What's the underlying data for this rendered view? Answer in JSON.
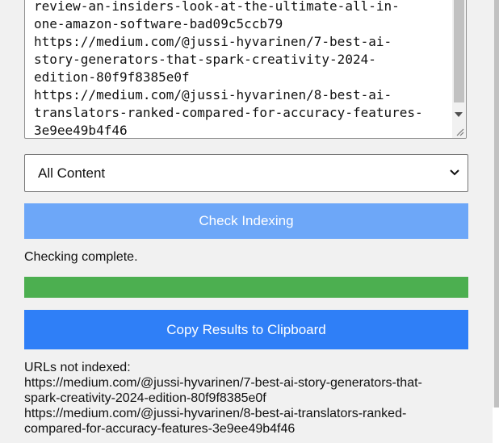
{
  "url_input": {
    "lines": [
      "review-an-insiders-look-at-the-ultimate-all-in-",
      "one-amazon-software-bad09c5ccb79",
      "https://medium.com/@jussi-hyvarinen/7-best-ai-",
      "story-generators-that-spark-creativity-2024-",
      "edition-80f9f8385e0f",
      "https://medium.com/@jussi-hyvarinen/8-best-ai-",
      "translators-ranked-compared-for-accuracy-features-",
      "3e9ee49b4f46"
    ]
  },
  "content_select": {
    "value": "All Content"
  },
  "buttons": {
    "check_label": "Check Indexing",
    "copy_label": "Copy Results to Clipboard"
  },
  "status": {
    "text": "Checking complete.",
    "progress_percent": 100,
    "progress_color": "#4caf50"
  },
  "results": {
    "heading": "URLs not indexed:",
    "lines": [
      "https://medium.com/@jussi-hyvarinen/7-best-ai-story-generators-that-",
      "spark-creativity-2024-edition-80f9f8385e0f",
      "https://medium.com/@jussi-hyvarinen/8-best-ai-translators-ranked-",
      "compared-for-accuracy-features-3e9ee49b4f46"
    ],
    "partial_text": "........"
  },
  "colors": {
    "check_button": "#6da7f8",
    "copy_button": "#2f7ff7",
    "background": "#f1f1f1"
  }
}
